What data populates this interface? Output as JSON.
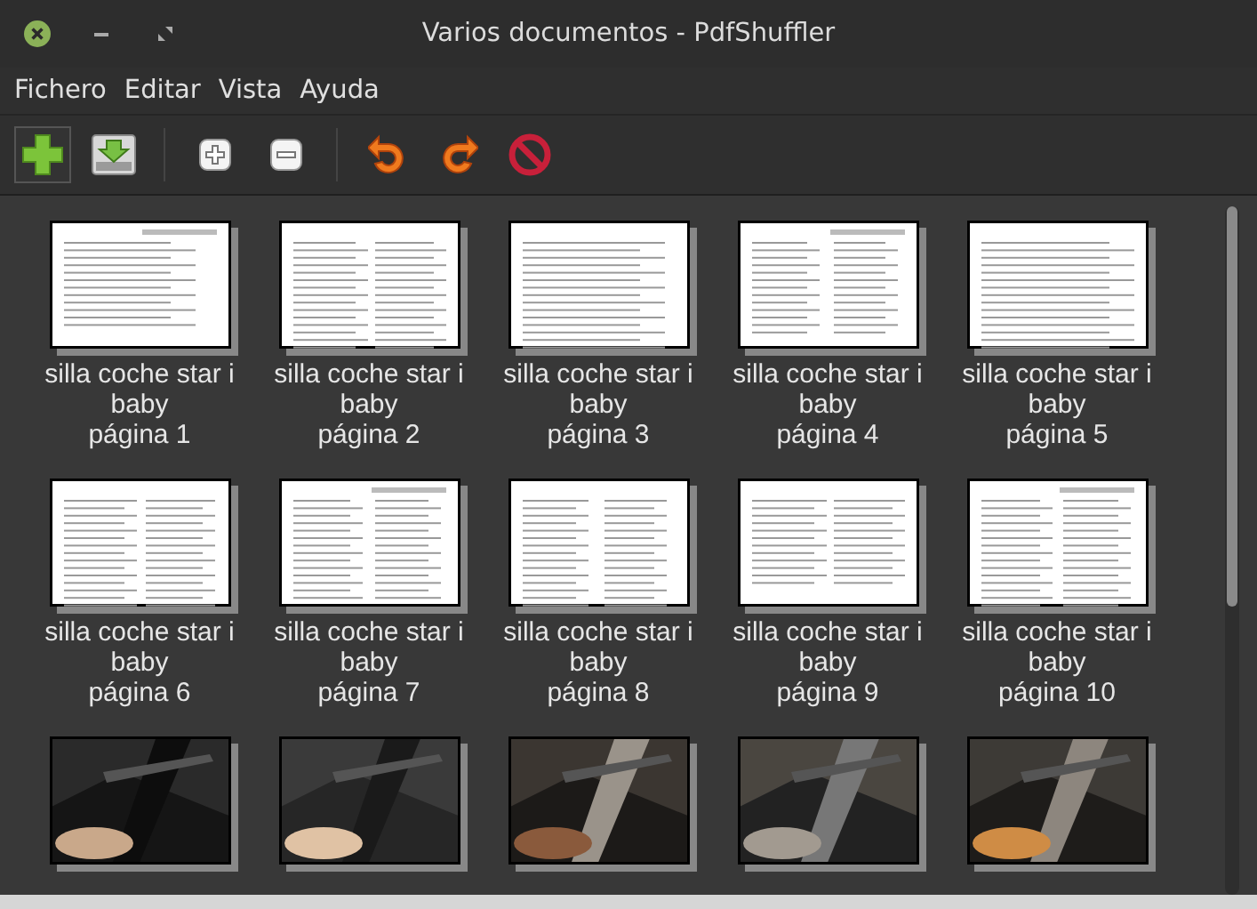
{
  "window": {
    "title": "Varios documentos - PdfShuffler"
  },
  "menu": [
    "Fichero",
    "Editar",
    "Vista",
    "Ayuda"
  ],
  "pages": [
    {
      "kind": "document",
      "name": "silla coche star i baby",
      "page": "página 1"
    },
    {
      "kind": "document",
      "name": "silla coche star i baby",
      "page": "página 2"
    },
    {
      "kind": "document",
      "name": "silla coche star i baby",
      "page": "página 3"
    },
    {
      "kind": "document",
      "name": "silla coche star i baby",
      "page": "página 4"
    },
    {
      "kind": "document",
      "name": "silla coche star i baby",
      "page": "página 5"
    },
    {
      "kind": "document",
      "name": "silla coche star i baby",
      "page": "página 6"
    },
    {
      "kind": "document",
      "name": "silla coche star i baby",
      "page": "página 7"
    },
    {
      "kind": "document",
      "name": "silla coche star i baby",
      "page": "página 8"
    },
    {
      "kind": "document",
      "name": "silla coche star i baby",
      "page": "página 9"
    },
    {
      "kind": "document",
      "name": "silla coche star i baby",
      "page": "página 10"
    },
    {
      "kind": "picture"
    },
    {
      "kind": "picture"
    },
    {
      "kind": "picture"
    },
    {
      "kind": "picture"
    },
    {
      "kind": "picture"
    }
  ]
}
